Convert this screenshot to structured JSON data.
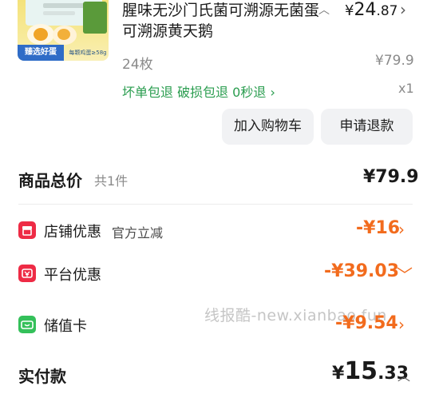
{
  "product": {
    "thumb_tag": "臻选好蛋",
    "thumb_note": "每颗鸡蛋≥58g",
    "title": "腥味无沙门氏菌可溯源无菌蛋可溯源黄天鹅",
    "price_currency": "¥",
    "price_int": "24",
    "price_dec": ".87",
    "spec": "24枚",
    "original_price": "¥79.9",
    "services": "坏单包退  破损包退  0秒退",
    "quantity": "x1"
  },
  "actions": {
    "add_cart": "加入购物车",
    "refund": "申请退款"
  },
  "summary": {
    "total_label": "商品总价",
    "total_count": "共1件",
    "total_value": "¥79.9"
  },
  "discounts": {
    "shop_label": "店铺优惠",
    "shop_sub": "官方立减",
    "shop_value": "-¥16",
    "platform_label": "平台优惠",
    "platform_value": "-¥39.03",
    "card_label": "储值卡",
    "card_value": "-¥9.54"
  },
  "watermark": "线报酷-new.xianbao.fun",
  "payment": {
    "label": "实付款",
    "currency": "¥",
    "int": "15",
    "dec": ".33"
  },
  "colors": {
    "discount": "#f26b1d",
    "service_green": "#2a9d4f",
    "shop_icon": "#ee2b45",
    "card_icon": "#34c05a"
  },
  "icons": {
    "expand": "chevron-up-icon",
    "more": "chevron-right-icon",
    "dropdown": "chevron-down-icon",
    "shop": "store-icon",
    "platform": "coupon-icon",
    "card": "card-icon"
  }
}
